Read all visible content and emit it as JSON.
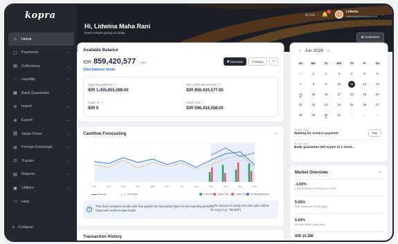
{
  "sidebar": {
    "logo": "kopra",
    "items": [
      {
        "label": "Home",
        "icon": "home-icon",
        "glyph": "⌂",
        "chev": ""
      },
      {
        "label": "Payments",
        "icon": "payments-icon",
        "glyph": "▢",
        "chev": "⌄"
      },
      {
        "label": "Collections",
        "icon": "collections-icon",
        "glyph": "▤",
        "chev": "⌄"
      },
      {
        "label": "Liquidity",
        "icon": "liquidity-icon",
        "glyph": "◌",
        "chev": "⌄"
      },
      {
        "label": "Bank Guarantee",
        "icon": "bank-guarantee-icon",
        "glyph": "▦",
        "chev": "⌄"
      },
      {
        "label": "Import",
        "icon": "import-icon",
        "glyph": "⊖",
        "chev": "⌄"
      },
      {
        "label": "Export",
        "icon": "export-icon",
        "glyph": "⊕",
        "chev": "⌄"
      },
      {
        "label": "Value Chain",
        "icon": "value-chain-icon",
        "glyph": "⛓",
        "chev": "⌄"
      },
      {
        "label": "Foreign Exchange",
        "icon": "foreign-exchange-icon",
        "glyph": "◍",
        "chev": "⌄"
      },
      {
        "label": "Tracker",
        "icon": "tracker-icon",
        "glyph": "⊡",
        "chev": "⌄"
      },
      {
        "label": "Reports",
        "icon": "reports-icon",
        "glyph": "▥",
        "chev": "⌄"
      },
      {
        "label": "Utilities",
        "icon": "utilities-icon",
        "glyph": "▣",
        "chev": "⌄"
      },
      {
        "label": "Help",
        "icon": "help-icon",
        "glyph": "▭",
        "chev": ""
      }
    ],
    "collapse": "Collapse"
  },
  "header": {
    "greeting": "Hi, Lidwina Maha Rani",
    "subtitle": "Here's what's going on today",
    "lang": "ID | EN",
    "notif_count": "2",
    "user_name": "Lidwina",
    "user_email": "Lidwina@pertamina.co.id",
    "customize": "Customize"
  },
  "balance": {
    "title": "Available Balance",
    "currency": "IDR",
    "amount": "859,420,577",
    "change": "↑ 58%",
    "view_detail": "View balance detail",
    "overview_btn": "Overview",
    "history_btn": "History",
    "opening_label": "Opening Balance ⓘ",
    "opening_value": "IDR 1,455,855,089.00",
    "net_label": "Net Cash Movement ⓘ",
    "net_value": "IDR 859,420,577.00",
    "cashin_label": "Cash In ⓘ",
    "cashin_value": "IDR 0",
    "cashout_label": "Cash Out ⓘ",
    "cashout_value": "IDR 596,434,508.00"
  },
  "cashflow": {
    "title": "Cashflow Forecasting",
    "legend_actual": "Actual",
    "legend_forecast": "Forecast",
    "legend_cashin": "Cash In",
    "legend_cashout": "Cash Out",
    "legend_cashout2": "Cash Out",
    "legend_ending": "Ending Balance",
    "note_left": "This chart compares actual cash flow against the forecasted figure for the reporting period to help track month-to-date health.",
    "note_right": "s. The amount is clearly the total cash outflow for ency (e.g., \"$3,000\")."
  },
  "history": {
    "title": "Transaction History"
  },
  "calendar": {
    "month": "Jun 2024",
    "days": [
      "Su",
      "Mo",
      "Tu",
      "We",
      "Th",
      "Fr",
      "Sa"
    ],
    "weeks": [
      [
        "31",
        "1",
        "2",
        "3",
        "4",
        "5",
        "6"
      ],
      [
        "7",
        "8",
        "9",
        "10",
        "11",
        "12",
        "13"
      ],
      [
        "14",
        "15",
        "16",
        "17",
        "18",
        "19",
        "20"
      ],
      [
        "21",
        "22",
        "23",
        "24",
        "25",
        "26",
        "27"
      ],
      [
        "28",
        "29",
        "30",
        "31",
        "1",
        "2",
        "3"
      ]
    ],
    "events": [
      {
        "date": "18 Jun 2024",
        "text": "Waiting for invoice payment",
        "action": "Pay"
      },
      {
        "date": "30 Jun 2024",
        "text": "Bank guarantee will expire in 1 mont..."
      }
    ]
  },
  "market": {
    "title": "Market Overview",
    "items": [
      {
        "value": "-1.50%",
        "label": "Current Account 2024F (% of GDP)"
      },
      {
        "value": "5.06%",
        "label": "PDB Indonesia 2024F (yoy)"
      },
      {
        "value": "5.50%",
        "label": "BI Rate 2024F (year end)"
      },
      {
        "value": "IDR 15.286",
        "label": ""
      }
    ]
  },
  "chart_data": {
    "type": "line",
    "title": "Cashflow Forecasting",
    "x": [
      "Jan",
      "Feb",
      "Mar",
      "Apr",
      "May",
      "Jun",
      "Jul",
      "Aug",
      "Sep",
      "Oct",
      "Nov",
      "Dec"
    ],
    "series": [
      {
        "name": "Actual",
        "values": [
          42,
          38,
          50,
          40,
          47,
          36,
          44,
          30,
          45,
          58,
          62,
          35
        ]
      },
      {
        "name": "Forecast",
        "values": [
          34,
          30,
          45,
          28,
          40,
          32,
          38,
          26,
          35,
          48,
          55,
          30
        ]
      },
      {
        "name": "Ending Balance",
        "values": [
          null,
          null,
          null,
          null,
          null,
          null,
          null,
          null,
          55,
          70,
          52,
          60
        ]
      }
    ],
    "bars": {
      "categories": [
        "Aug",
        "Sep",
        "Oct",
        "Nov"
      ],
      "cash_in": [
        20,
        35,
        25,
        38
      ],
      "cash_out": [
        30,
        18,
        40,
        22
      ]
    },
    "colors": {
      "actual": "#2a6cd6",
      "forecast": "#e3a93b",
      "cash_in": "#21a366",
      "cash_out": "#e25b6a",
      "ending": "#3b7be0"
    }
  }
}
